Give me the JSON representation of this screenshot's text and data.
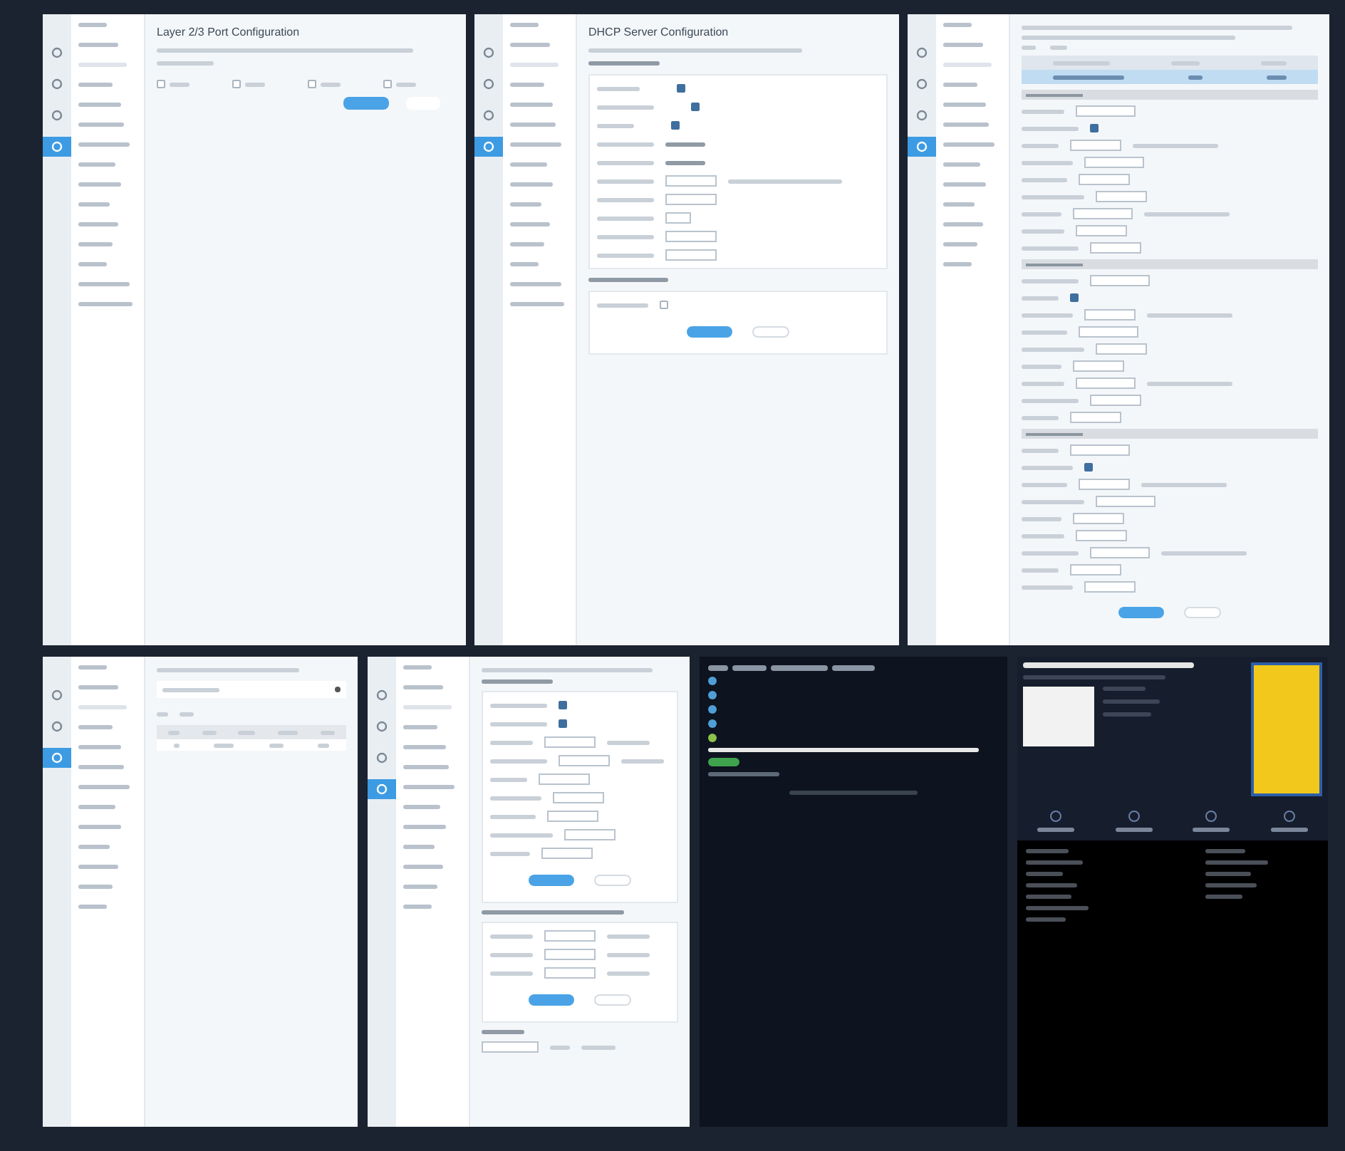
{
  "panels": [
    {
      "kind": "ports",
      "title": "Layer 2/3 Port Configuration",
      "rail": [
        {
          "selected": false
        },
        {
          "selected": false
        },
        {
          "selected": false
        },
        {
          "selected": true
        }
      ],
      "checkboxes": [
        {
          "checked": false
        },
        {
          "checked": false
        },
        {
          "checked": false
        },
        {
          "checked": false
        }
      ]
    },
    {
      "kind": "dhcp",
      "title": "DHCP Server Configuration",
      "rail": [
        {
          "selected": false
        },
        {
          "selected": false
        },
        {
          "selected": false
        },
        {
          "selected": true
        }
      ],
      "checkboxes": [
        {
          "checked": true
        },
        {
          "checked": true
        },
        {
          "checked": true
        },
        {
          "checked": false
        }
      ]
    },
    {
      "kind": "wan",
      "rail": [
        {
          "selected": false
        },
        {
          "selected": false
        },
        {
          "selected": false
        },
        {
          "selected": true
        }
      ],
      "checkboxes": [
        {
          "checked": true
        },
        {
          "checked": true
        },
        {
          "checked": true
        }
      ]
    },
    {
      "kind": "table",
      "rail": [
        {
          "selected": false
        },
        {
          "selected": false
        },
        {
          "selected": true
        }
      ]
    },
    {
      "kind": "form",
      "rail": [
        {
          "selected": false
        },
        {
          "selected": false
        },
        {
          "selected": false
        },
        {
          "selected": true
        }
      ],
      "checkboxes": [
        {
          "checked": true
        },
        {
          "checked": true
        }
      ]
    },
    {
      "kind": "terminal"
    },
    {
      "kind": "website"
    }
  ]
}
